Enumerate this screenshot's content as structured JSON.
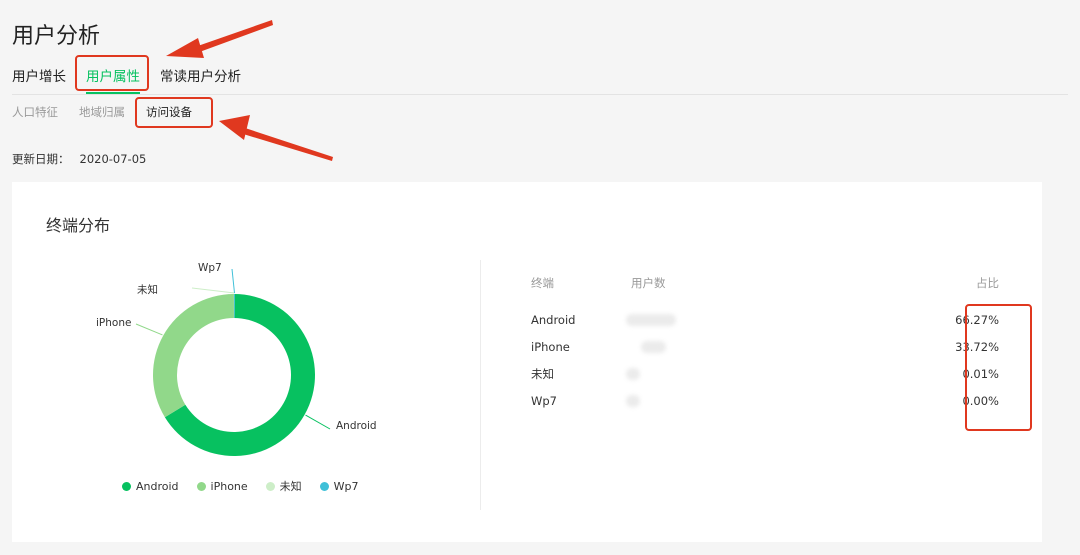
{
  "page": {
    "title": "用户分析"
  },
  "main_tabs": [
    {
      "label": "用户增长",
      "active": false
    },
    {
      "label": "用户属性",
      "active": true
    },
    {
      "label": "常读用户分析",
      "active": false
    }
  ],
  "sub_tabs": [
    {
      "label": "人口特征",
      "active": false
    },
    {
      "label": "地域归属",
      "active": false
    },
    {
      "label": "访问设备",
      "active": true
    }
  ],
  "update": {
    "label": "更新日期：",
    "value": "2020-07-05"
  },
  "card": {
    "title": "终端分布"
  },
  "colors": {
    "accent": "#07c160",
    "annotation": "#e0381f",
    "android": "#07c160",
    "iphone": "#91d88a",
    "unknown": "#cdeec8",
    "wp7": "#3fc0d8"
  },
  "chart_data": {
    "type": "pie",
    "categories": [
      "Android",
      "iPhone",
      "未知",
      "Wp7"
    ],
    "values": [
      66.27,
      33.72,
      0.01,
      0.0
    ],
    "legend_position": "bottom"
  },
  "table": {
    "headers": {
      "terminal": "终端",
      "users": "用户数",
      "share": "占比"
    },
    "rows": [
      {
        "terminal": "Android",
        "share": "66.27%"
      },
      {
        "terminal": "iPhone",
        "share": "33.72%"
      },
      {
        "terminal": "未知",
        "share": "0.01%"
      },
      {
        "terminal": "Wp7",
        "share": "0.00%"
      }
    ]
  }
}
